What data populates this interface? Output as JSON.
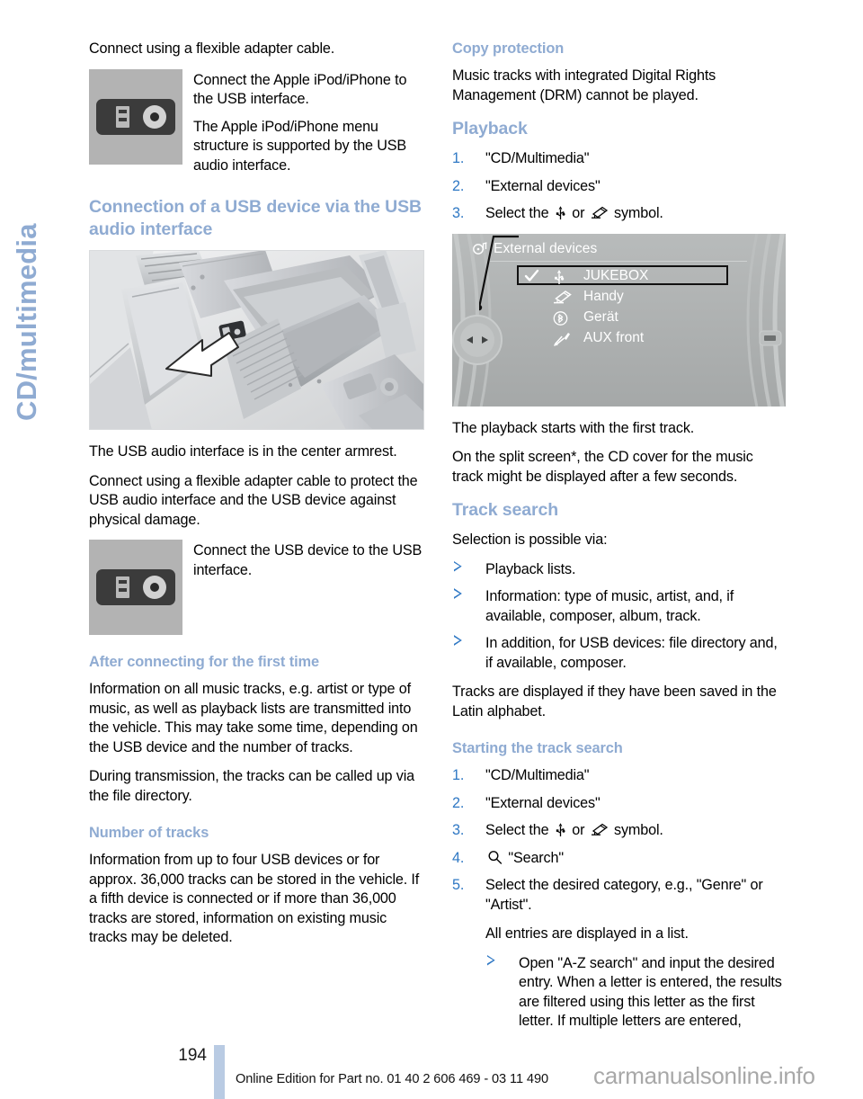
{
  "chapter_tab": {
    "label": "CD/multimedia"
  },
  "left_column": {
    "intro_paragraph": "Connect using a flexible adapter cable.",
    "fig_ipod": {
      "icon_name": "usb-aux-port-illustration",
      "lines": [
        "Connect the Apple iPod/iPhone to the USB interface.",
        "The Apple iPod/iPhone menu structure is supported by the USB audio interface."
      ]
    },
    "heading_connection": "Connection of a USB device via the USB audio interface",
    "photo_armrest_name": "center-armrest-photo",
    "para_armrest": "The USB audio interface is in the center armrest.",
    "para_protect": "Connect using a flexible adapter cable to protect the USB audio interface and the USB device against physical damage.",
    "fig_usb": {
      "icon_name": "usb-aux-port-illustration",
      "lines": [
        "Connect the USB device to the USB interface."
      ]
    },
    "heading_first_time": "After connecting for the first time",
    "para_first_time_1": "Information on all music tracks, e.g. artist or type of music, as well as playback lists are transmitted into the vehicle. This may take some time, depending on the USB device and the number of tracks.",
    "para_first_time_2": "During transmission, the tracks can be called up via the file directory.",
    "heading_number_of_tracks": "Number of tracks",
    "para_number_of_tracks": "Information from up to four USB devices or for approx. 36,000 tracks can be stored in the vehicle. If a fifth device is connected or if more than 36,000 tracks are stored, information on existing music tracks may be deleted."
  },
  "right_column": {
    "heading_copy_protection": "Copy protection",
    "para_copy_protection": "Music tracks with integrated Digital Rights Management (DRM) cannot be played.",
    "heading_playback": "Playback",
    "playback_steps": [
      {
        "text": "\"CD/Multimedia\""
      },
      {
        "text": "\"External devices\""
      },
      {
        "pre": "Select the",
        "mid": "or",
        "post": "symbol."
      }
    ],
    "idrive_screen": {
      "title": "External devices",
      "title_icon": "multimedia-icon",
      "items": [
        {
          "label": "JUKEBOX",
          "icon": "usb-icon",
          "checked": true,
          "highlighted": true
        },
        {
          "label": "Handy",
          "icon": "phone-icon",
          "checked": false,
          "highlighted": false
        },
        {
          "label": "Gerät",
          "icon": "bluetooth-icon",
          "checked": false,
          "highlighted": false
        },
        {
          "label": "AUX front",
          "icon": "aux-plug-icon",
          "checked": false,
          "highlighted": false
        }
      ]
    },
    "para_playback_starts": "The playback starts with the first track.",
    "para_split_screen": "On the split screen*, the CD cover for the music track might be displayed after a few seconds.",
    "heading_track_search": "Track search",
    "para_selection": "Selection is possible via:",
    "selection_bullets": [
      "Playback lists.",
      "Information: type of music, artist, and, if available, composer, album, track.",
      "In addition, for USB devices: file directory and, if available, composer."
    ],
    "para_latin": "Tracks are displayed if they have been saved in the Latin alphabet.",
    "heading_starting_search": "Starting the track search",
    "search_steps": [
      {
        "text": "\"CD/Multimedia\""
      },
      {
        "text": "\"External devices\""
      },
      {
        "pre": "Select the",
        "mid": "or",
        "post": "symbol."
      },
      {
        "icon": "search-icon",
        "text": "\"Search\""
      },
      {
        "text": "Select the desired category, e.g., \"Genre\" or \"Artist\"."
      }
    ],
    "para_all_entries": "All entries are displayed in a list.",
    "nested_bullet": "Open \"A-Z search\" and input the desired entry. When a letter is entered, the results are filtered using this letter as the first letter. If multiple letters are entered,"
  },
  "footer": {
    "page_number": "194",
    "edition_text": "Online Edition for Part no. 01 40 2 606 469 - 03 11 490",
    "watermark": "carmanualsonline.info"
  },
  "colors": {
    "heading_blue": "#8fabd2",
    "step_number_blue": "#2f78c4",
    "footer_bar_blue": "#b9cbe3",
    "port_gray": "#b3b3b3",
    "screen_gray": "#b0b3b3"
  }
}
